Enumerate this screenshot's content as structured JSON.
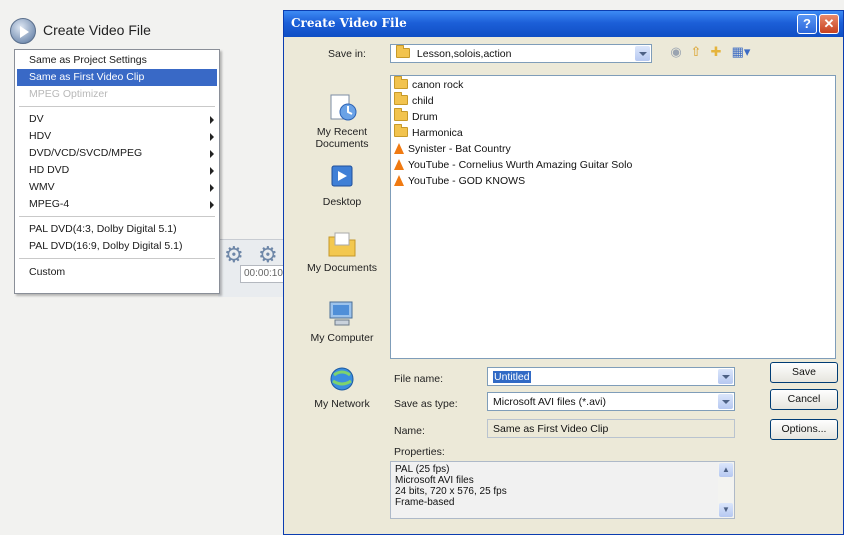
{
  "menu": {
    "title": "Create Video File",
    "items": [
      {
        "label": "Same as Project Settings",
        "state": "normal",
        "submenu": false
      },
      {
        "label": "Same as First Video Clip",
        "state": "selected",
        "submenu": false
      },
      {
        "label": "MPEG Optimizer",
        "state": "disabled",
        "submenu": false
      },
      {
        "label": "DV",
        "state": "normal",
        "submenu": true
      },
      {
        "label": "HDV",
        "state": "normal",
        "submenu": true
      },
      {
        "label": "DVD/VCD/SVCD/MPEG",
        "state": "normal",
        "submenu": true
      },
      {
        "label": "HD DVD",
        "state": "normal",
        "submenu": true
      },
      {
        "label": "WMV",
        "state": "normal",
        "submenu": true
      },
      {
        "label": "MPEG-4",
        "state": "normal",
        "submenu": true
      },
      {
        "label": "PAL  DVD(4:3, Dolby Digital 5.1)",
        "state": "normal",
        "submenu": false
      },
      {
        "label": "PAL  DVD(16:9, Dolby Digital 5.1)",
        "state": "normal",
        "submenu": false
      },
      {
        "label": "Custom",
        "state": "normal",
        "submenu": false
      }
    ],
    "timecode": "00:00:10"
  },
  "dialog": {
    "title": "Create Video File",
    "help_label": "?",
    "close_label": "✕",
    "save_in_label": "Save in:",
    "save_in_value": "Lesson,solois,action",
    "places": [
      {
        "label": "My Recent Documents",
        "icon": "recent-documents-icon"
      },
      {
        "label": "Desktop",
        "icon": "desktop-icon"
      },
      {
        "label": "My Documents",
        "icon": "my-documents-icon"
      },
      {
        "label": "My Computer",
        "icon": "my-computer-icon"
      },
      {
        "label": "My Network",
        "icon": "my-network-icon"
      }
    ],
    "files": [
      {
        "name": "canon rock",
        "type": "folder"
      },
      {
        "name": "child",
        "type": "folder"
      },
      {
        "name": "Drum",
        "type": "folder"
      },
      {
        "name": "Harmonica",
        "type": "folder"
      },
      {
        "name": "Synister -  Bat Country",
        "type": "vlc"
      },
      {
        "name": "YouTube - Cornelius Wurth Amazing Guitar Solo",
        "type": "vlc"
      },
      {
        "name": "YouTube - GOD KNOWS",
        "type": "vlc"
      }
    ],
    "file_name_label": "File name:",
    "file_name_value": "Untitled",
    "save_as_type_label": "Save as type:",
    "save_as_type_value": "Microsoft AVI files (*.avi)",
    "name_label": "Name:",
    "name_value": "Same as First Video Clip",
    "properties_label": "Properties:",
    "properties_lines": [
      "PAL (25 fps)",
      "Microsoft AVI files",
      "24 bits, 720 x 576, 25 fps",
      "Frame-based"
    ],
    "save_button": "Save",
    "cancel_button": "Cancel",
    "options_button": "Options..."
  },
  "colors": {
    "titlebar": "#1c5fd8",
    "selection": "#3969c6",
    "dialog_bg": "#ece9d8"
  }
}
